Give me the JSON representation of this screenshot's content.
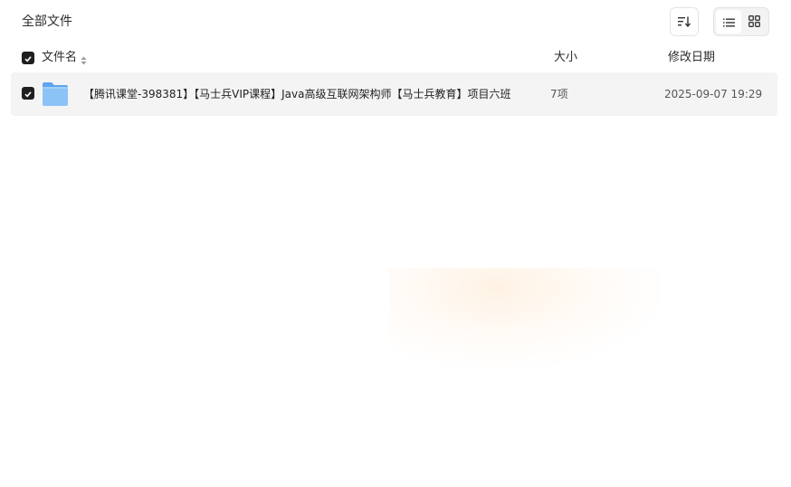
{
  "breadcrumb": {
    "title": "全部文件"
  },
  "toolbar": {
    "sort_icon": "sort-icon",
    "list_view_icon": "list-view-icon",
    "grid_view_icon": "grid-view-icon",
    "active_view": "list"
  },
  "table": {
    "columns": {
      "name": "文件名",
      "size": "大小",
      "date": "修改日期"
    },
    "select_all_checked": true,
    "rows": [
      {
        "checked": true,
        "icon": "folder-icon",
        "name": "【腾讯课堂-398381】【马士兵VIP课程】Java高级互联网架构师【马士兵教育】项目六班",
        "size": "7项",
        "date": "2025-09-07 19:29"
      }
    ]
  },
  "colors": {
    "checkbox": "#1f1f1f",
    "row_bg": "#f4f4f4",
    "folder": "#7fb8f2"
  }
}
